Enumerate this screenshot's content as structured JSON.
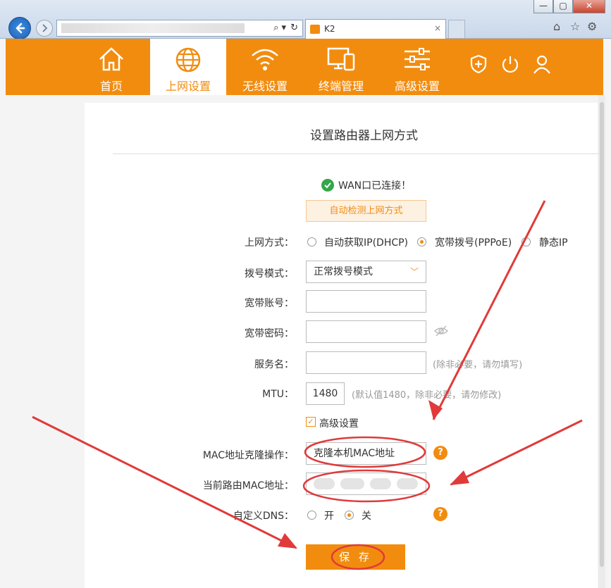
{
  "browser": {
    "tab_title": "K2",
    "tab_close": "×",
    "url_icons": [
      "⌕ ▾",
      "↻"
    ],
    "window_buttons": [
      "—",
      "▢",
      "✕"
    ],
    "right_icons": [
      "⌂",
      "☆",
      "⚙"
    ]
  },
  "nav": {
    "items": [
      {
        "label": "首页",
        "icon": "home-icon"
      },
      {
        "label": "上网设置",
        "icon": "globe-icon",
        "active": true
      },
      {
        "label": "无线设置",
        "icon": "wifi-icon"
      },
      {
        "label": "终端管理",
        "icon": "devices-icon"
      },
      {
        "label": "高级设置",
        "icon": "sliders-icon"
      }
    ],
    "side_icons": [
      "shield-plus-icon",
      "power-icon",
      "user-icon"
    ]
  },
  "page": {
    "title": "设置路由器上网方式",
    "status": "WAN口已连接！",
    "auto_detect_button": "自动检测上网方式"
  },
  "form": {
    "conn_mode_label": "上网方式：",
    "conn_modes": [
      "自动获取IP(DHCP)",
      "宽带拨号(PPPoE)",
      "静态IP"
    ],
    "conn_mode_selected": "宽带拨号(PPPoE)",
    "dial_mode_label": "拨号模式：",
    "dial_mode_value": "正常拨号模式",
    "account_label": "宽带账号：",
    "password_label": "宽带密码：",
    "service_label": "服务名：",
    "service_hint": "(除非必要，请勿填写)",
    "mtu_label": "MTU：",
    "mtu_value": "1480",
    "mtu_hint": "(默认值1480，除非必要，请勿修改)",
    "advanced_label": "高级设置",
    "mac_clone_label": "MAC地址克隆操作：",
    "mac_clone_value": "克隆本机MAC地址",
    "current_mac_label": "当前路由MAC地址：",
    "current_mac_value": "",
    "dns_label": "自定义DNS：",
    "dns_on": "开",
    "dns_off": "关",
    "dns_selected": "关",
    "help_icon": "?",
    "save_button": "保 存"
  },
  "colors": {
    "brand_orange": "#f28c0f",
    "annotation_red": "#e03a3a",
    "success_green": "#35a64a"
  }
}
